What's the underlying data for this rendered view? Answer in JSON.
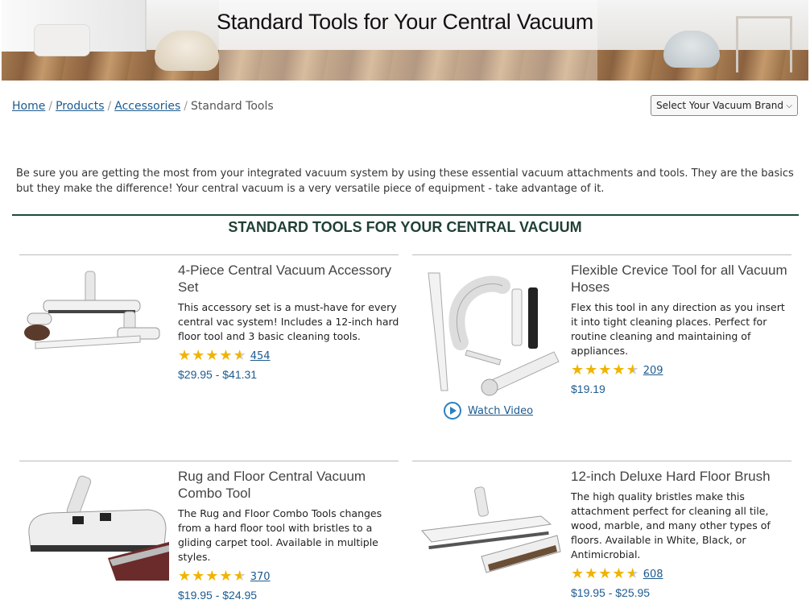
{
  "hero": {
    "title": "Standard Tools for Your Central Vacuum"
  },
  "breadcrumb": {
    "items": [
      "Home",
      "Products",
      "Accessories"
    ],
    "current": "Standard Tools"
  },
  "brand_select": {
    "selected": "Select Your Vacuum Brand"
  },
  "intro": "Be sure you are getting the most from your integrated vacuum system by using these essential vacuum attachments and tools. They are the basics but they make the difference! Your central vacuum is a very versatile piece of equipment - take advantage of it.",
  "section_title": "STANDARD TOOLS FOR YOUR CENTRAL VACUUM",
  "products": [
    {
      "title": "4-Piece Central Vacuum Accessory Set",
      "desc": "This accessory set is a must-have for every central vac system! Includes a 12-inch hard floor tool and 3 basic cleaning tools.",
      "rating": 4.5,
      "reviews": "454",
      "price": "$29.95 - $41.31"
    },
    {
      "title": "Flexible Crevice Tool for all Vacuum Hoses",
      "desc": "Flex this tool in any direction as you insert it into tight cleaning places. Perfect for routine cleaning and maintaining of appliances.",
      "rating": 4.5,
      "reviews": "209",
      "price": "$19.19",
      "video_label": "Watch Video"
    },
    {
      "title": "Rug and Floor Central Vacuum Combo Tool",
      "desc": "The Rug and Floor Combo Tools changes from a hard floor tool with bristles to a gliding carpet tool. Available in multiple styles.",
      "rating": 4.5,
      "reviews": "370",
      "price": "$19.95 - $24.95"
    },
    {
      "title": "12-inch Deluxe Hard Floor Brush",
      "desc": "The high quality bristles make this attachment perfect for cleaning all tile, wood, marble, and many other types of floors. Available in White, Black, or Antimicrobial.",
      "rating": 4.5,
      "reviews": "608",
      "price": "$19.95 - $25.95"
    }
  ],
  "colors": {
    "link": "#1d5b8f",
    "star": "#f0b400",
    "section": "#1f3f35"
  }
}
